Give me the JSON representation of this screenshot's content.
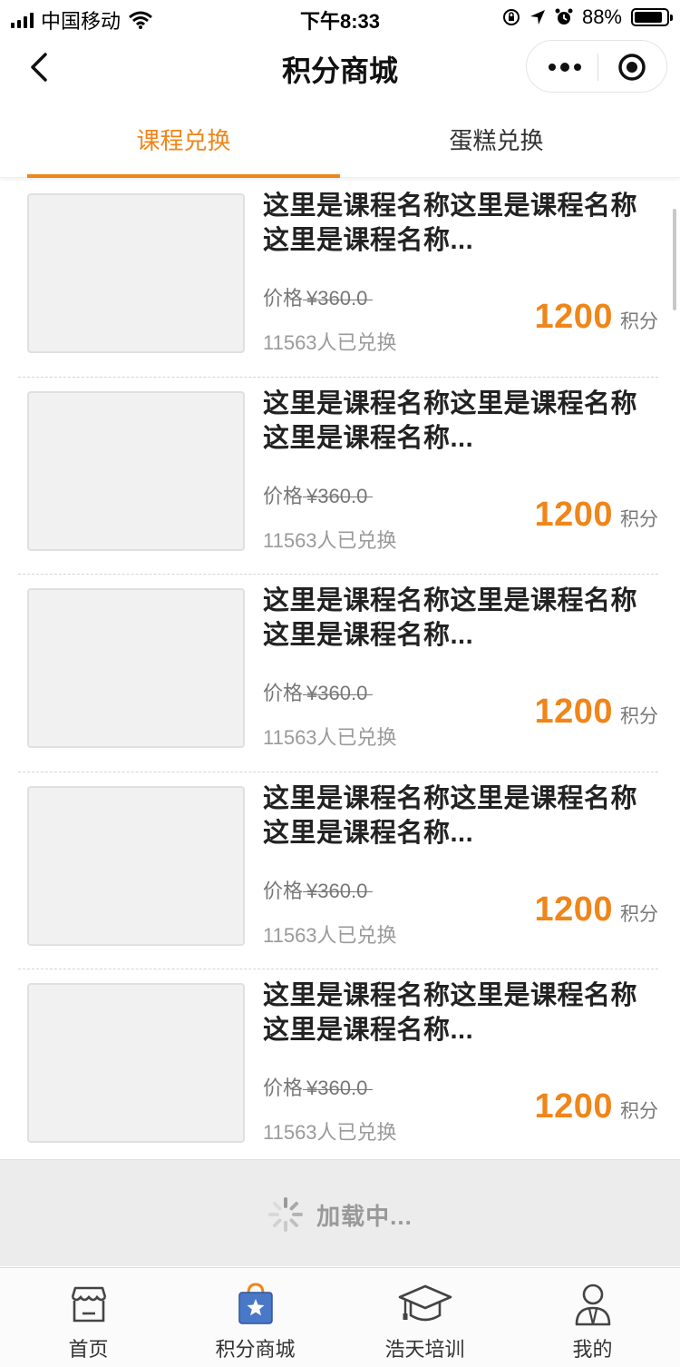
{
  "status_bar": {
    "carrier": "中国移动",
    "time": "下午8:33",
    "battery": "88%",
    "battery_level": 0.88
  },
  "nav": {
    "title": "积分商城"
  },
  "tabs": [
    {
      "label": "课程兑换",
      "active": true
    },
    {
      "label": "蛋糕兑换",
      "active": false
    }
  ],
  "items": [
    {
      "title": "这里是课程名称这里是课程名称这里是课程名称...",
      "price_label": "价格",
      "price": "¥360.0",
      "exchanged": "11563人已兑换",
      "points": "1200",
      "points_unit": "积分"
    },
    {
      "title": "这里是课程名称这里是课程名称这里是课程名称...",
      "price_label": "价格",
      "price": "¥360.0",
      "exchanged": "11563人已兑换",
      "points": "1200",
      "points_unit": "积分"
    },
    {
      "title": "这里是课程名称这里是课程名称这里是课程名称...",
      "price_label": "价格",
      "price": "¥360.0",
      "exchanged": "11563人已兑换",
      "points": "1200",
      "points_unit": "积分"
    },
    {
      "title": "这里是课程名称这里是课程名称这里是课程名称...",
      "price_label": "价格",
      "price": "¥360.0",
      "exchanged": "11563人已兑换",
      "points": "1200",
      "points_unit": "积分"
    },
    {
      "title": "这里是课程名称这里是课程名称这里是课程名称...",
      "price_label": "价格",
      "price": "¥360.0",
      "exchanged": "11563人已兑换",
      "points": "1200",
      "points_unit": "积分"
    }
  ],
  "loading": {
    "text": "加载中..."
  },
  "tabbar": [
    {
      "label": "首页",
      "icon": "store-icon"
    },
    {
      "label": "积分商城",
      "icon": "shopping-bag-star-icon"
    },
    {
      "label": "浩天培训",
      "icon": "graduation-cap-icon"
    },
    {
      "label": "我的",
      "icon": "user-icon"
    }
  ],
  "colors": {
    "accent": "#f08519",
    "tab_icon_blue": "#4a78c8"
  }
}
